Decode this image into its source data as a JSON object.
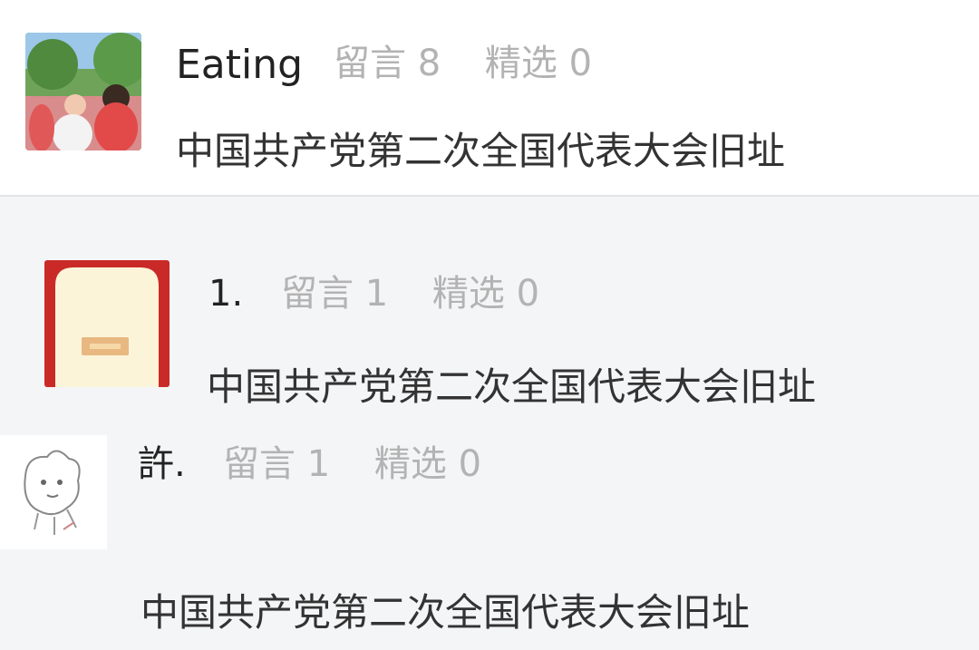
{
  "users": [
    {
      "name": "Eating",
      "messages_label": "留言 8",
      "featured_label": "精选 0",
      "text": "中国共产党第二次全国代表大会旧址",
      "avatar": "photo-avatar"
    },
    {
      "name": "1.",
      "messages_label": "留言 1",
      "featured_label": "精选 0",
      "text": "中国共产党第二次全国代表大会旧址",
      "avatar": "red-envelope-avatar"
    },
    {
      "name": "許.",
      "messages_label": "留言 1",
      "featured_label": "精选 0",
      "text": "中国共产党第二次全国代表大会旧址",
      "avatar": "sketch-avatar"
    }
  ],
  "colors": {
    "name": "#222222",
    "meta": "#b3b3b3",
    "text": "#333333",
    "background_top": "#ffffff",
    "background_rest": "#f4f5f7",
    "envelope_red": "#c92a28",
    "envelope_cream": "#fcf4d9"
  }
}
